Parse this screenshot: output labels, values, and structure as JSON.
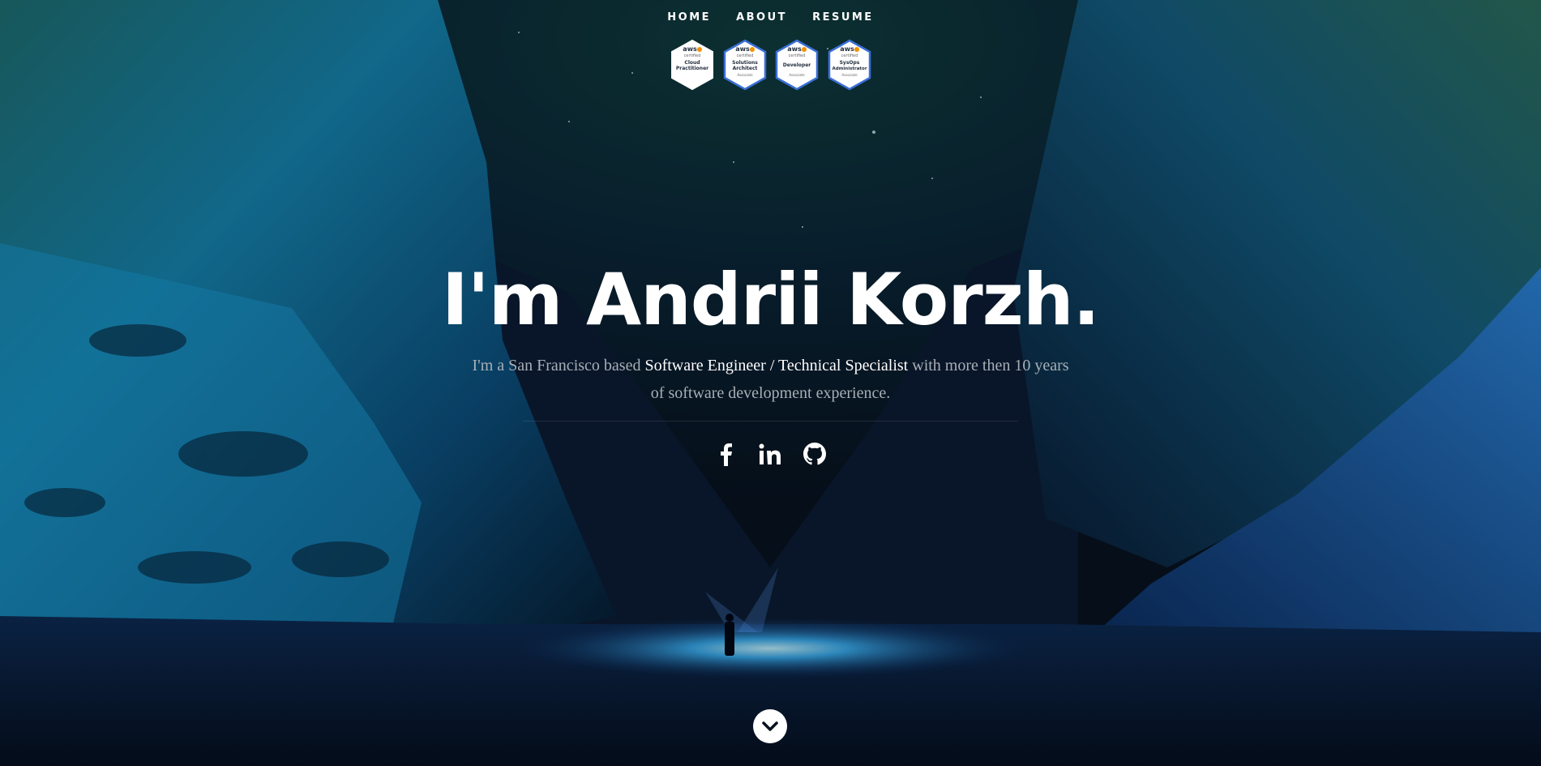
{
  "nav": {
    "items": [
      {
        "label": "HOME"
      },
      {
        "label": "ABOUT"
      },
      {
        "label": "RESUME"
      }
    ]
  },
  "badges": [
    {
      "brand": "aws",
      "line1": "certified",
      "title1": "Cloud",
      "title2": "Practitioner",
      "level": "",
      "border": "#ffffff"
    },
    {
      "brand": "aws",
      "line1": "certified",
      "title1": "Solutions",
      "title2": "Architect",
      "level": "Associate",
      "border": "#3b6fd6"
    },
    {
      "brand": "aws",
      "line1": "certified",
      "title1": "Developer",
      "title2": "",
      "level": "Associate",
      "border": "#3b6fd6"
    },
    {
      "brand": "aws",
      "line1": "certified",
      "title1": "SysOps",
      "title2": "Administrator",
      "level": "Associate",
      "border": "#3b6fd6"
    }
  ],
  "hero": {
    "title": "I'm Andrii Korzh.",
    "tagline_prefix": "I'm a San Francisco based ",
    "tagline_highlight": "Software Engineer / Technical Specialist",
    "tagline_suffix": " with more then 10 years of software development experience."
  },
  "social": [
    {
      "icon": "facebook-icon"
    },
    {
      "icon": "linkedin-icon"
    },
    {
      "icon": "github-icon"
    }
  ],
  "scroll": {
    "icon": "chevron-down-icon"
  },
  "colors": {
    "text_white": "#ffffff",
    "text_muted": "#a7afb6",
    "badge_border": "#3b6fd6",
    "aws_orange": "#f29100"
  }
}
